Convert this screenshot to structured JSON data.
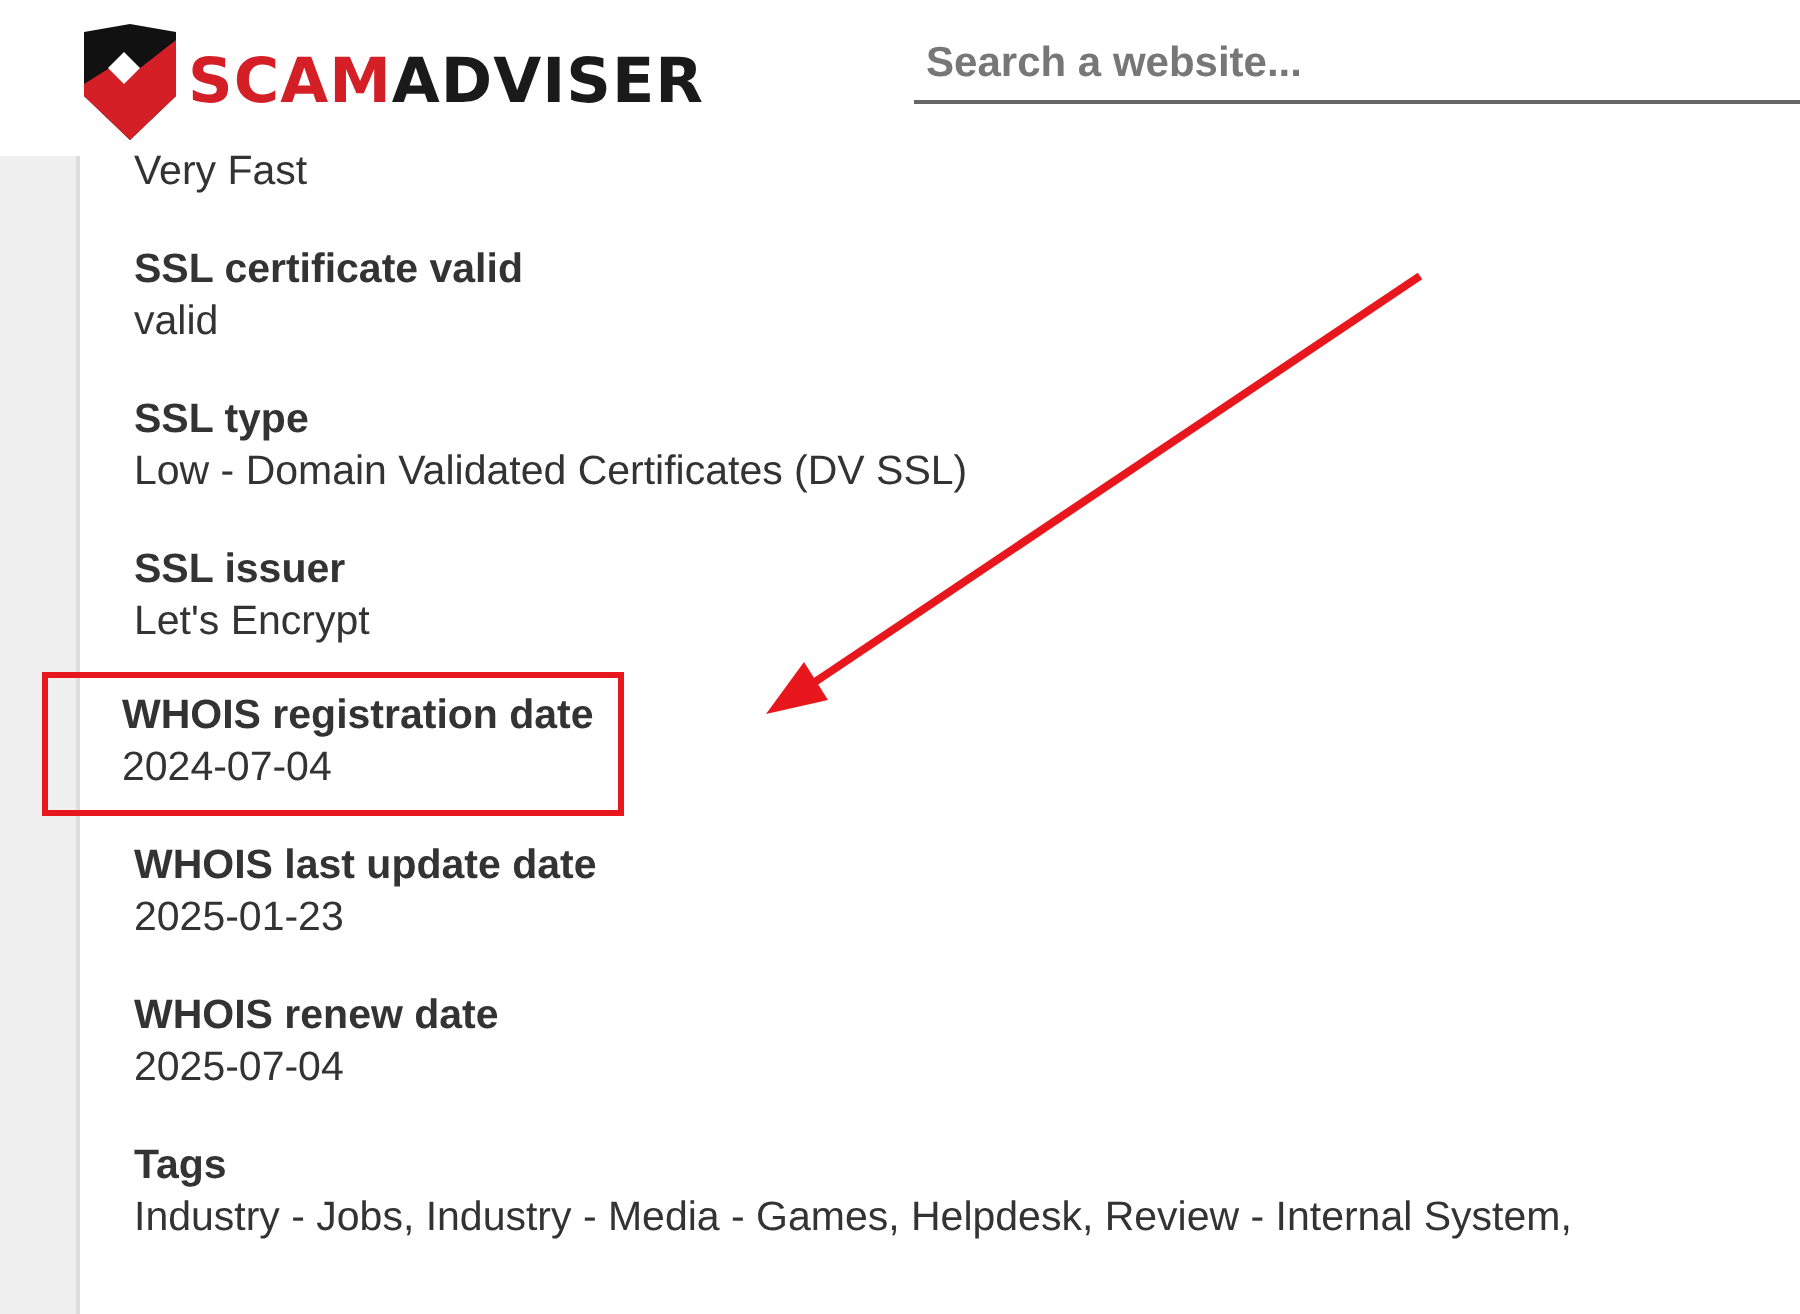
{
  "header": {
    "logo": {
      "part_1": "SCAM",
      "part_2": "ADVISER"
    },
    "search": {
      "placeholder": "Search a website..."
    }
  },
  "details": [
    {
      "value": "Very Fast",
      "highlighted": false
    },
    {
      "label": "SSL certificate valid",
      "value": "valid",
      "highlighted": false
    },
    {
      "label": "SSL type",
      "value": "Low - Domain Validated Certificates (DV SSL)",
      "highlighted": false
    },
    {
      "label": "SSL issuer",
      "value": "Let's Encrypt",
      "highlighted": false
    },
    {
      "label": "WHOIS registration date",
      "value": "2024-07-04",
      "highlighted": true
    },
    {
      "label": "WHOIS last update date",
      "value": "2025-01-23",
      "highlighted": false
    },
    {
      "label": "WHOIS renew date",
      "value": "2025-07-04",
      "highlighted": false
    },
    {
      "label": "Tags",
      "value": "Industry - Jobs, Industry - Media - Games, Helpdesk, Review - Internal System,",
      "highlighted": false
    }
  ]
}
